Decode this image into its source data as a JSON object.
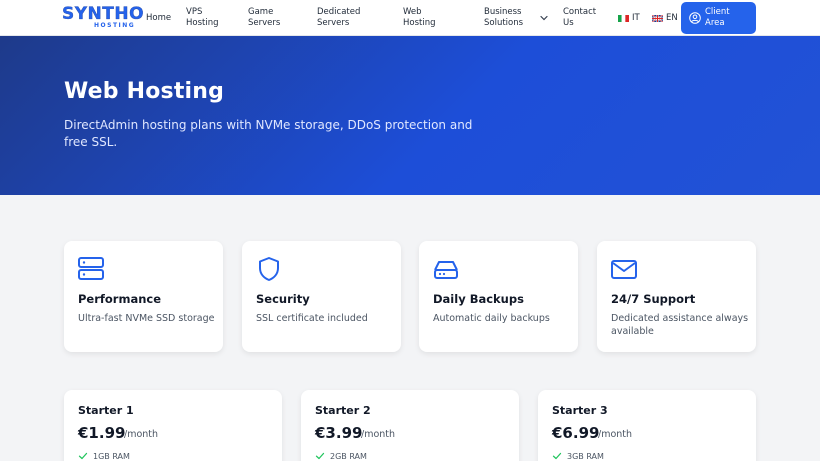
{
  "brand": {
    "name": "SYNTHO",
    "sub": "HOSTING",
    "color": "#2563eb"
  },
  "nav": {
    "home": "Home",
    "vps": "VPS\nHosting",
    "game": "Game\nServers",
    "dedicated": "Dedicated\nServers",
    "web": "Web\nHosting",
    "business": "Business\nSolutions",
    "contact": "Contact\nUs",
    "lang_it": "IT",
    "lang_en": "EN",
    "client_area": "Client\nArea"
  },
  "hero": {
    "title": "Web Hosting",
    "subtitle": "DirectAdmin hosting plans with NVMe storage, DDoS protection and free SSL."
  },
  "features": [
    {
      "icon": "server-icon",
      "title": "Performance",
      "desc": "Ultra-fast NVMe SSD storage"
    },
    {
      "icon": "shield-icon",
      "title": "Security",
      "desc": "SSL certificate included"
    },
    {
      "icon": "hard-drive-icon",
      "title": "Daily Backups",
      "desc": "Automatic daily backups"
    },
    {
      "icon": "mail-icon",
      "title": "24/7 Support",
      "desc": "Dedicated assistance always available"
    }
  ],
  "plans": [
    {
      "name": "Starter 1",
      "price": "€1.99",
      "period": "/month",
      "feature": "1GB RAM"
    },
    {
      "name": "Starter 2",
      "price": "€3.99",
      "period": "/month",
      "feature": "2GB RAM"
    },
    {
      "name": "Starter 3",
      "price": "€6.99",
      "period": "/month",
      "feature": "3GB RAM"
    }
  ],
  "colors": {
    "accent": "#2563eb",
    "hero_dark": "#1e3a8a",
    "check": "#22c55e"
  }
}
